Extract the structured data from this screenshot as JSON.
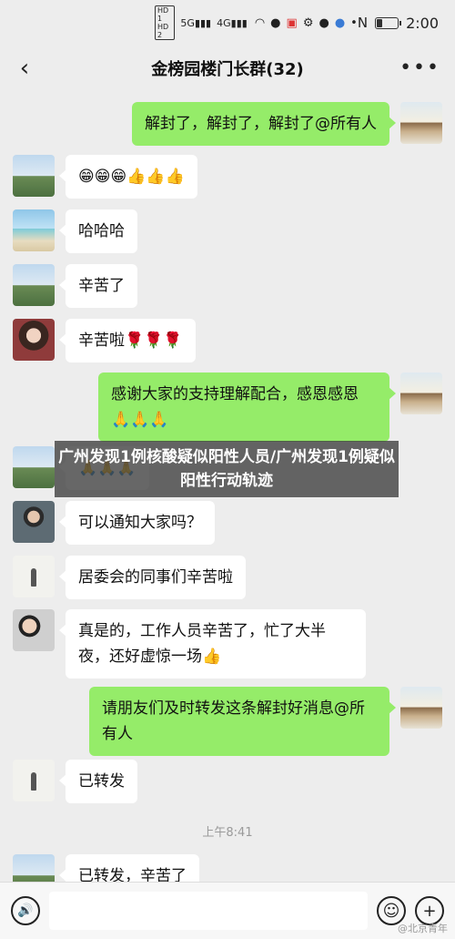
{
  "status_bar": {
    "hd_top": "HD 1",
    "hd_bottom": "HD 2",
    "signal_1": "5G",
    "signal_2": "4G",
    "nfc": "N",
    "battery_level": 0.25,
    "time": "2:00"
  },
  "header": {
    "back_icon": "‹",
    "title": "金榜园楼门长群(32)",
    "more_icon": "•••"
  },
  "messages": [
    {
      "side": "right",
      "avatar": "sunset",
      "text": "解封了，解封了，解封了@所有人"
    },
    {
      "side": "left",
      "avatar": "city",
      "text": "😁😁😁👍👍👍"
    },
    {
      "side": "left",
      "avatar": "beach",
      "text": "哈哈哈"
    },
    {
      "side": "left",
      "avatar": "city",
      "text": "辛苦了"
    },
    {
      "side": "left",
      "avatar": "girl",
      "text": "辛苦啦🌹🌹🌹"
    },
    {
      "side": "right",
      "avatar": "sunset",
      "text": "感谢大家的支持理解配合，感恩感恩🙏🙏🙏"
    },
    {
      "side": "left",
      "avatar": "city",
      "text": "🙏🙏🙏"
    },
    {
      "side": "left",
      "avatar": "person",
      "text": "可以通知大家吗？"
    },
    {
      "side": "left",
      "avatar": "fig",
      "text": "居委会的同事们辛苦啦"
    },
    {
      "side": "left",
      "avatar": "family",
      "text": "真是的，工作人员辛苦了，忙了大半夜，还好虚惊一场👍"
    },
    {
      "side": "right",
      "avatar": "sunset",
      "text": "请朋友们及时转发这条解封好消息@所有人"
    },
    {
      "side": "left",
      "avatar": "fig",
      "text": "已转发"
    },
    {
      "side": "left",
      "avatar": "city",
      "text": "已转发，辛苦了"
    }
  ],
  "timestamp": "上午8:41",
  "overlay": {
    "headline": "广州发现1例核酸疑似阳性人员/广州发现1例疑似阳性行动轨迹"
  },
  "input_bar": {
    "voice_icon": "🔊",
    "emoji_icon": "☺",
    "plus_icon": "+",
    "placeholder": ""
  },
  "watermark": "@北京青年"
}
